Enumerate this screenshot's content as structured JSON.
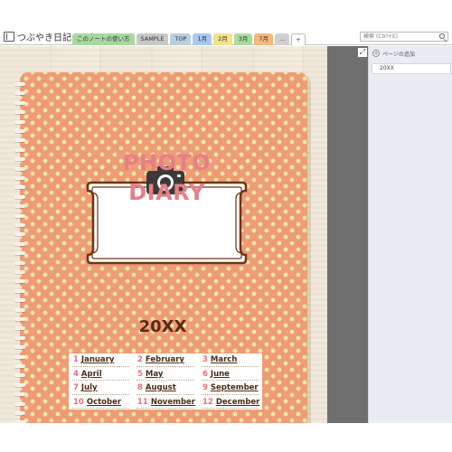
{
  "notebook": {
    "title": "つぶやき日記"
  },
  "tabs": [
    {
      "label": "このノートの使い方",
      "color": "#a8d8a0"
    },
    {
      "label": "SAMPLE",
      "color": "#c8c8c8"
    },
    {
      "label": "TOP",
      "color": "#b9cfe2"
    },
    {
      "label": "1月",
      "color": "#a9c9ee"
    },
    {
      "label": "2月",
      "color": "#f3e28a"
    },
    {
      "label": "3月",
      "color": "#a8dca0"
    },
    {
      "label": "7月",
      "color": "#f2b97c"
    },
    {
      "label": "...",
      "color": "#d0d0d0"
    },
    {
      "label": "+",
      "color": "#ffffff"
    }
  ],
  "search": {
    "placeholder": "検索 (Ctrl+E)",
    "icon": "search-icon"
  },
  "cover": {
    "title_line1": "PHOTO",
    "title_line2": "DIARY",
    "year": "20XX",
    "background": "#ee9b76",
    "dot_color": "#f2e8a8",
    "title_color": "#e67f86",
    "icon": "camera-icon"
  },
  "months": [
    {
      "num": "1",
      "name": "January"
    },
    {
      "num": "2",
      "name": "February"
    },
    {
      "num": "3",
      "name": "March"
    },
    {
      "num": "4",
      "name": "April"
    },
    {
      "num": "5",
      "name": "May"
    },
    {
      "num": "6",
      "name": "June"
    },
    {
      "num": "7",
      "name": "July"
    },
    {
      "num": "8",
      "name": "August"
    },
    {
      "num": "9",
      "name": "September"
    },
    {
      "num": "10",
      "name": "October"
    },
    {
      "num": "11",
      "name": "November"
    },
    {
      "num": "12",
      "name": "December"
    }
  ],
  "panel": {
    "add_page_label": "ページの追加",
    "pages": [
      "20XX"
    ]
  }
}
